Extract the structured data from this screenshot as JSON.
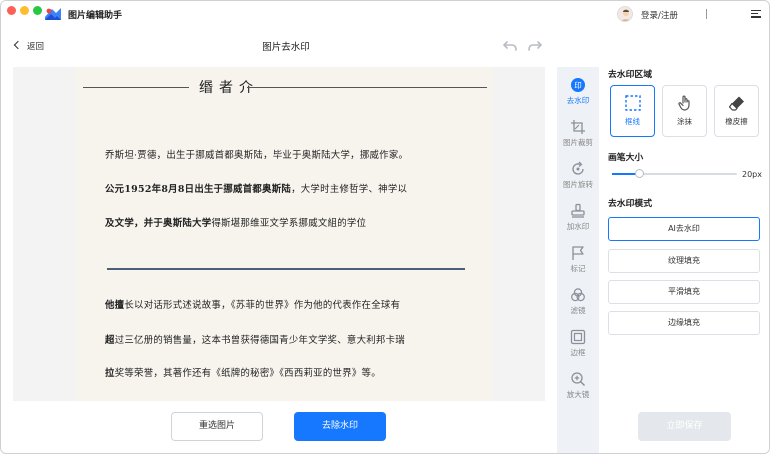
{
  "app": {
    "title": "图片编辑助手",
    "login_label": "登录/注册"
  },
  "toolbar": {
    "back_label": "返回",
    "page_title": "图片去水印"
  },
  "document": {
    "heading": "缗者介",
    "paragraph1": [
      "乔斯坦·贾德，出生于挪威首都奥斯陆，毕业于奥斯陆大学，挪威作家。",
      "公元1952年8月8日出生于挪威首都奥斯陆，大学时主修哲学、神学以",
      "及文学，并于奥斯陆大学得斯堪那维亚文学系挪威文組的学位"
    ],
    "paragraph2": [
      "他擅长以对话形式述说故事，《苏菲的世界》作为他的代表作在全球有",
      "超过三亿册的销售量，这本书曾获得德国青少年文学奖、意大利邦卡瑞",
      "拉奖等荣誉，其著作还有《纸牌的秘密》《西西莉亚的世界》等。"
    ]
  },
  "actions": {
    "reselect_label": "重选图片",
    "remove_label": "去除水印",
    "save_label": "立即保存"
  },
  "tools": [
    {
      "label": "去水印",
      "icon": "watermark-icon",
      "active": true
    },
    {
      "label": "图片裁剪",
      "icon": "crop-icon"
    },
    {
      "label": "图片旋转",
      "icon": "rotate-icon"
    },
    {
      "label": "加水印",
      "icon": "stamp-icon"
    },
    {
      "label": "标记",
      "icon": "flag-icon"
    },
    {
      "label": "滤镜",
      "icon": "filter-icon"
    },
    {
      "label": "边框",
      "icon": "frame-icon"
    },
    {
      "label": "放大镜",
      "icon": "zoom-icon"
    }
  ],
  "panel": {
    "area_title": "去水印区域",
    "area_modes": [
      {
        "label": "框线",
        "icon": "select-box-icon",
        "active": true
      },
      {
        "label": "涂抹",
        "icon": "hand-icon"
      },
      {
        "label": "橡皮擦",
        "icon": "eraser-icon"
      }
    ],
    "brush_title": "画笔大小",
    "brush_value": "20px",
    "brush_fraction": 0.22,
    "mode_title": "去水印模式",
    "modes": [
      {
        "label": "AI去水印",
        "active": true
      },
      {
        "label": "纹理填充"
      },
      {
        "label": "平滑填充"
      },
      {
        "label": "边缘填充"
      }
    ]
  },
  "colors": {
    "accent": "#1677ff",
    "tool_strip": "#eef1f5",
    "doc_bg": "#f7f4ee",
    "divider": "#4b5f79"
  }
}
